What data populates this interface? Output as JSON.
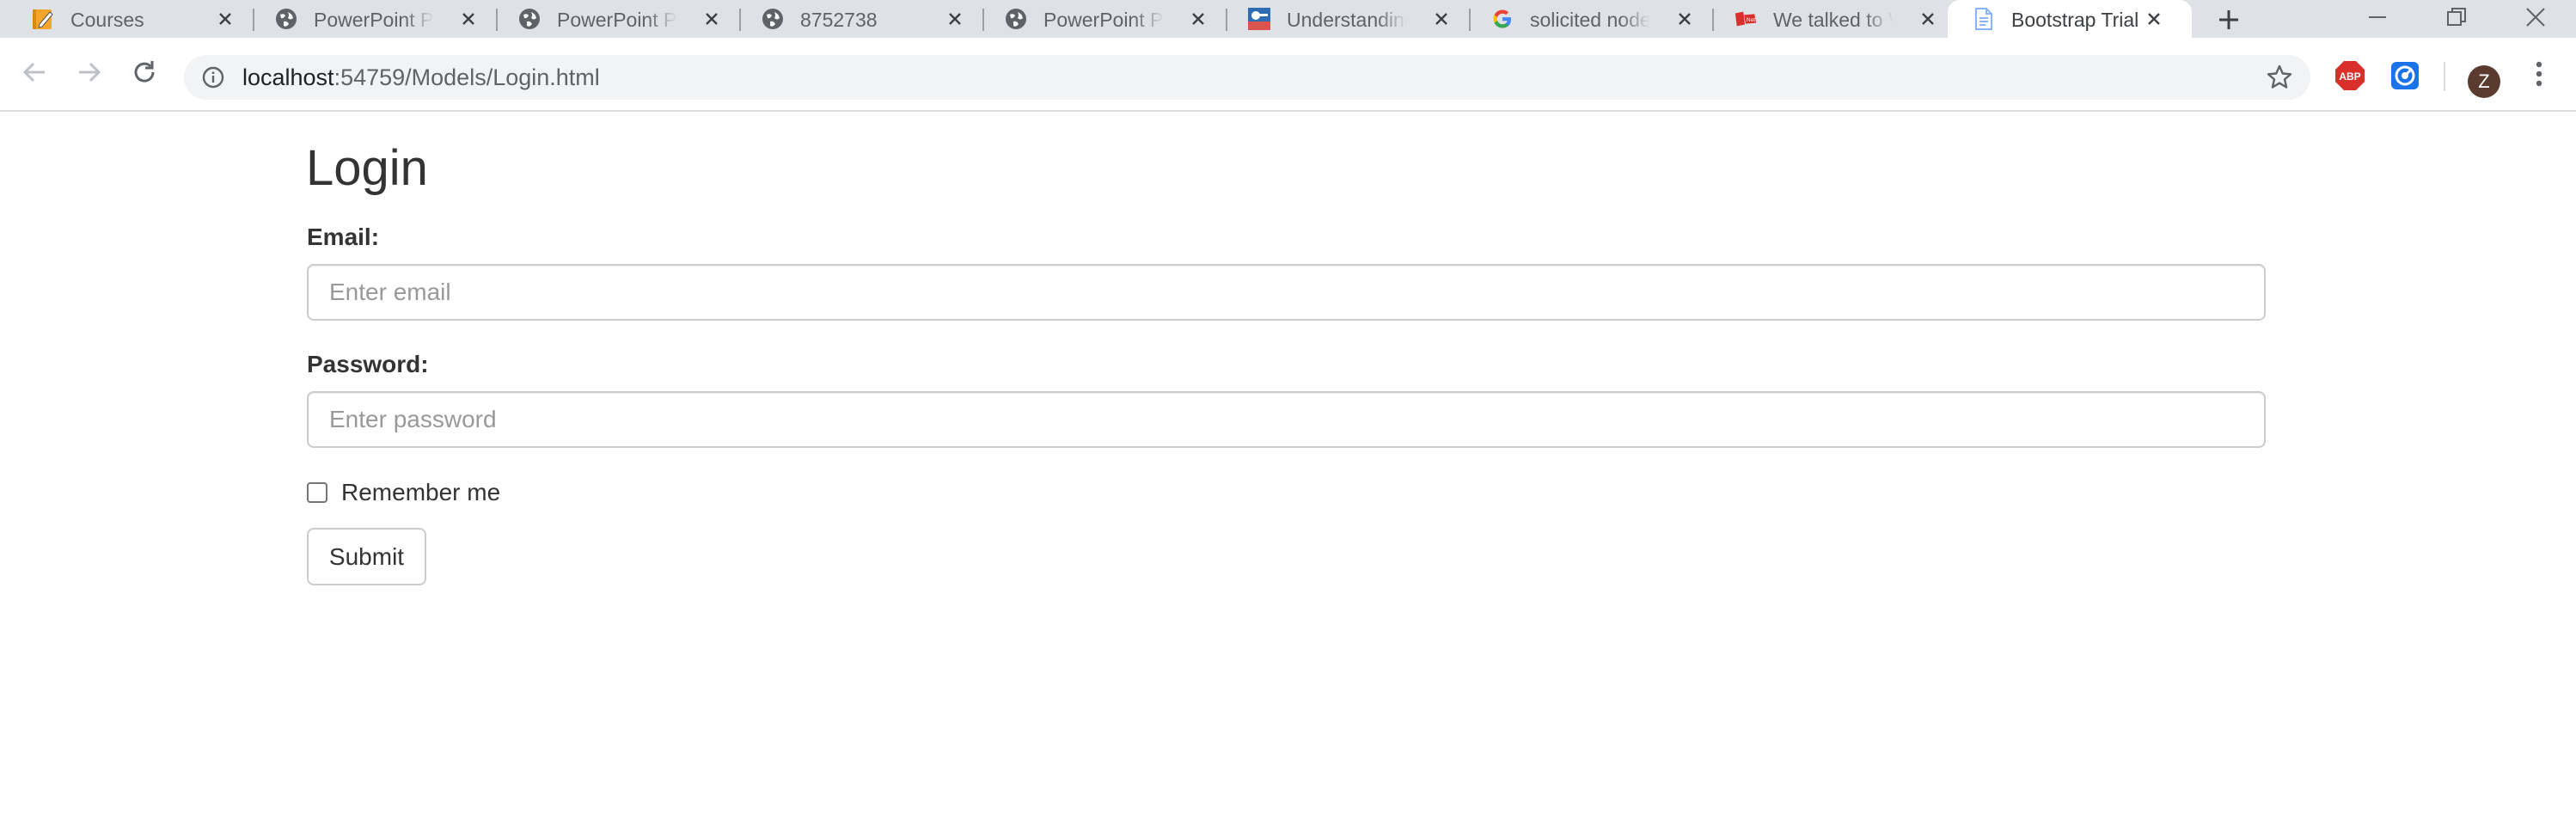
{
  "browser": {
    "tabs": [
      {
        "title": "Courses",
        "icon": "pencil-notebook-icon"
      },
      {
        "title": "PowerPoint Pre",
        "icon": "globe-icon"
      },
      {
        "title": "PowerPoint Pre",
        "icon": "globe-icon"
      },
      {
        "title": "8752738",
        "icon": "globe-icon"
      },
      {
        "title": "PowerPoint Pre",
        "icon": "globe-icon"
      },
      {
        "title": "Understanding",
        "icon": "site-thumbnail-icon"
      },
      {
        "title": "solicited node",
        "icon": "google-icon"
      },
      {
        "title": "We talked to V",
        "icon": "news-site-icon"
      },
      {
        "title": "Bootstrap Trial",
        "icon": "document-icon",
        "active": true
      }
    ],
    "address": {
      "host": "localhost",
      "path": ":54759/Models/Login.html"
    },
    "extensions": [
      {
        "name": "adblock-plus",
        "label": "ABP"
      },
      {
        "name": "extension-2",
        "label": ""
      }
    ],
    "profile_initial": "Z",
    "colors": {
      "tabstrip": "#dee1e6",
      "omnibox": "#f1f3f4",
      "abp_red": "#d9302c",
      "avatar": "#5b3b30"
    }
  },
  "page": {
    "heading": "Login",
    "email": {
      "label": "Email:",
      "placeholder": "Enter email",
      "value": ""
    },
    "password": {
      "label": "Password:",
      "placeholder": "Enter password",
      "value": ""
    },
    "remember": {
      "label": "Remember me",
      "checked": false
    },
    "submit_label": "Submit"
  }
}
